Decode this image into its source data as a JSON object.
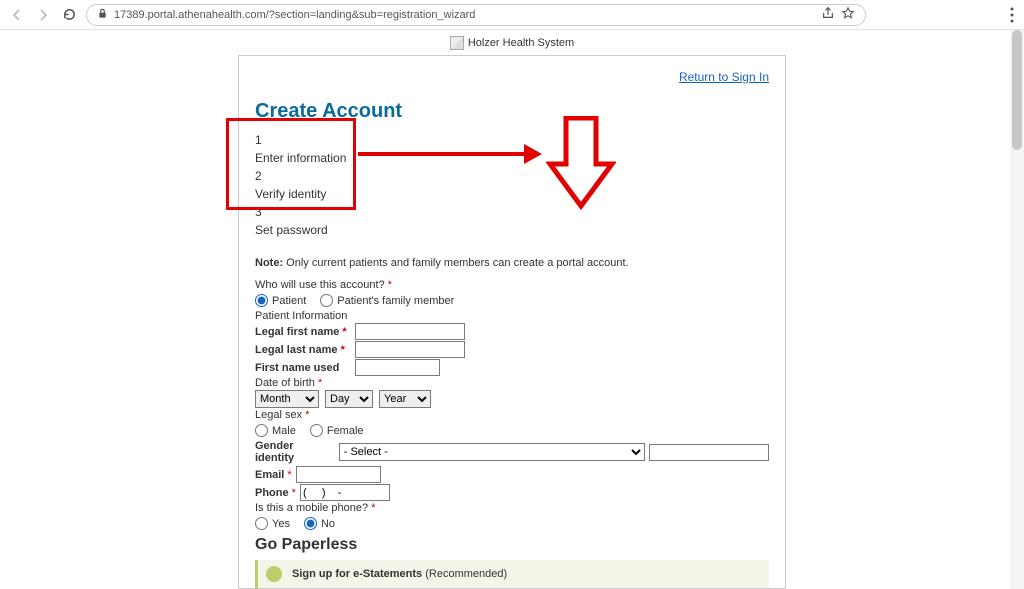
{
  "browser": {
    "url": "17389.portal.athenahealth.com/?section=landing&sub=registration_wizard"
  },
  "logo_text": "Holzer Health System",
  "signin_link": "Return to Sign In",
  "heading": "Create Account",
  "steps": {
    "n1": "1",
    "s1": "Enter information",
    "n2": "2",
    "s2": "Verify identity",
    "n3": "3",
    "s3": "Set password"
  },
  "note_label": "Note:",
  "note_text": " Only current patients and family members can create a portal account.",
  "who_question": "Who will use this account? ",
  "who_patient": "Patient",
  "who_family": "Patient's family member",
  "patient_info_heading": "Patient Information",
  "labels": {
    "legal_first": "Legal first name ",
    "legal_last": "Legal last name ",
    "first_used": "First name used",
    "dob": "Date of birth ",
    "legal_sex": "Legal sex ",
    "male": "Male",
    "female": "Female",
    "gender_identity": "Gender identity",
    "gender_select": "- Select -",
    "email": "Email ",
    "phone": "Phone ",
    "phone_placeholder": "(     )    -",
    "mobile_q": "Is this a mobile phone? ",
    "yes": "Yes",
    "no": "No",
    "month": "Month",
    "day": "Day",
    "year": "Year"
  },
  "go_paperless": "Go Paperless",
  "estatements_text": "Sign up for e-Statements ",
  "estatements_rec": "(Recommended)",
  "asterisk": "*"
}
